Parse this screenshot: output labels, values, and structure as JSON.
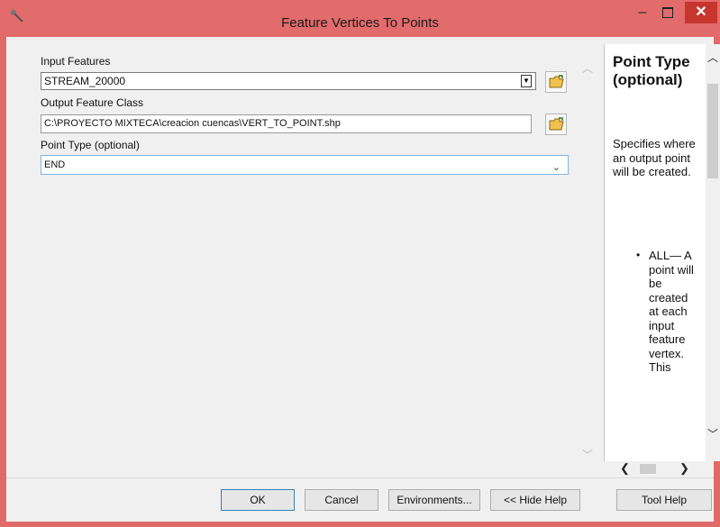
{
  "window": {
    "title": "Feature Vertices To Points",
    "minimize_glyph": "–",
    "close_glyph": "✕"
  },
  "params": {
    "input_label": "Input Features",
    "input_value": "STREAM_20000",
    "output_label": "Output Feature Class",
    "output_value": "C:\\PROYECTO MIXTECA\\creacion cuencas\\VERT_TO_POINT.shp",
    "point_type_label": "Point Type (optional)",
    "point_type_value": "END"
  },
  "help": {
    "title": "Point Type (optional)",
    "description": "Specifies where an output point will be created.",
    "bullet_text": "ALL— A point will be created at each input feature vertex. This"
  },
  "buttons": {
    "ok": "OK",
    "cancel": "Cancel",
    "environments": "Environments...",
    "hide_help": "<< Hide Help",
    "tool_help": "Tool Help"
  },
  "colors": {
    "titlebar": "#e26b6b",
    "close_button": "#c7362e",
    "focus_border": "#7eb4ea"
  },
  "icons": {
    "title": "hammer-icon",
    "folder": "open-folder-icon"
  }
}
